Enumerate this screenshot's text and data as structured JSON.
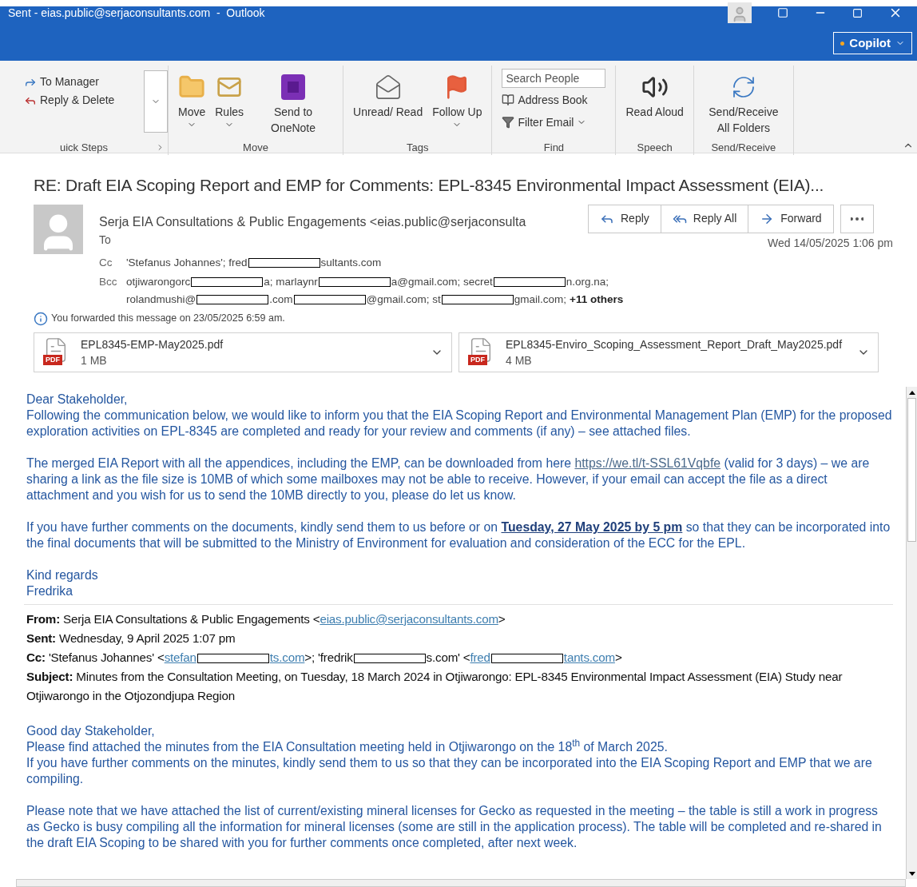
{
  "window": {
    "title": "Sent - eias.public@serjaconsultants.com  -  Outlook"
  },
  "copilot": {
    "label": "Copilot"
  },
  "ribbon": {
    "groups": [
      {
        "kind": "quicksteps",
        "label": "uick Steps",
        "items": [
          {
            "label": "To Manager"
          },
          {
            "label": "Reply & Delete"
          }
        ]
      },
      {
        "kind": "large",
        "label": "Move",
        "items": [
          {
            "label": "Move",
            "dropdown": true
          },
          {
            "label": "Rules",
            "dropdown": true
          },
          {
            "label": "Send to OneNote",
            "dropdown": false
          }
        ]
      },
      {
        "kind": "large",
        "label": "Tags",
        "items": [
          {
            "label": "Unread/ Read",
            "dropdown": false
          },
          {
            "label": "Follow Up",
            "dropdown": true
          }
        ]
      },
      {
        "kind": "find",
        "label": "Find",
        "search": {
          "placeholder": "Search People"
        },
        "items": [
          {
            "label": "Address Book",
            "dropdown": false
          },
          {
            "label": "Filter Email",
            "dropdown": true
          }
        ]
      },
      {
        "kind": "large",
        "label": "Speech",
        "items": [
          {
            "label": "Read Aloud",
            "dropdown": false
          }
        ]
      },
      {
        "kind": "large",
        "label": "Send/Receive",
        "items": [
          {
            "label": "Send/Receive All Folders",
            "dropdown": false
          }
        ]
      }
    ]
  },
  "message": {
    "subject": "RE: Draft EIA Scoping Report and EMP for Comments: EPL-8345 Environmental Impact Assessment (EIA)...",
    "sender": "Serja EIA Consultations & Public Engagements <eias.public@serjaconsulta",
    "date": "Wed 14/05/2025 1:06 pm",
    "actions": [
      {
        "label": "Reply"
      },
      {
        "label": "Reply All"
      },
      {
        "label": "Forward"
      }
    ],
    "to_label": "To",
    "recipients": [
      {
        "label": "Cc",
        "lines": [
          [
            {
              "kind": "text",
              "text": "'Stefanus Johannes'; fred"
            },
            {
              "kind": "redacted"
            },
            {
              "kind": "text",
              "text": "sultants.com"
            }
          ]
        ]
      },
      {
        "label": "Bcc",
        "lines": [
          [
            {
              "kind": "text",
              "text": "otjiwarongorc"
            },
            {
              "kind": "redacted"
            },
            {
              "kind": "text",
              "text": "a; marlaynr"
            },
            {
              "kind": "redacted"
            },
            {
              "kind": "text",
              "text": "a@gmail.com; secret"
            },
            {
              "kind": "redacted"
            },
            {
              "kind": "text",
              "text": "n.org.na;"
            }
          ],
          [
            {
              "kind": "text",
              "text": "rolandmushi@"
            },
            {
              "kind": "redacted"
            },
            {
              "kind": "text",
              "text": ".com"
            },
            {
              "kind": "redacted"
            },
            {
              "kind": "text",
              "text": "@gmail.com; st"
            },
            {
              "kind": "redacted"
            },
            {
              "kind": "text",
              "text": "gmail.com;"
            },
            {
              "kind": "bold",
              "text": "+11 others"
            }
          ]
        ]
      }
    ],
    "info": "You forwarded this message on 23/05/2025 6:59 am.",
    "attachments": [
      {
        "name": "EPL8345-EMP-May2025.pdf",
        "size": "1 MB",
        "badge": "PDF"
      },
      {
        "name": "EPL8345-Enviro_Scoping_Assessment_Report_Draft_May2025.pdf",
        "size": "4 MB",
        "badge": "PDF"
      }
    ]
  },
  "body": {
    "blocks": [
      [
        [
          {
            "kind": "text",
            "text": "Dear Stakeholder,"
          }
        ],
        [
          {
            "kind": "text",
            "text": "Following the communication below, we would like to inform you that the EIA Scoping Report and Environmental Management Plan (EMP) for the proposed exploration activities on EPL-8345 are completed and ready for your review and comments (if any) – see attached files."
          }
        ]
      ],
      [
        [
          {
            "kind": "text",
            "text": "The merged EIA Report with all the appendices, including the EMP, can be downloaded from here "
          },
          {
            "kind": "link",
            "text": "https://we.tl/t-SSL61Vqbfe"
          },
          {
            "kind": "text",
            "text": "  (valid for 3 days) – we are sharing a link as the file size is 10MB of which some mailboxes may not be able to receive. However, if your email can accept the file as a direct attachment and you wish for us to send the 10MB directly to you, please do let us know."
          }
        ]
      ],
      [
        [
          {
            "kind": "text",
            "text": "If you have further comments on the documents, kindly send them to us before or on "
          },
          {
            "kind": "emphasis",
            "text": "Tuesday, 27 May 2025 by 5 pm"
          },
          {
            "kind": "text",
            "text": " so that they can be incorporated into the final documents that will be submitted to the Ministry of Environment for evaluation and consideration of the ECC for the EPL."
          }
        ]
      ],
      [
        [
          {
            "kind": "text",
            "text": "Kind regards"
          }
        ],
        [
          {
            "kind": "text",
            "text": "Fredrika"
          }
        ]
      ]
    ],
    "forwarded": [
      {
        "label": "From:",
        "parts": [
          {
            "kind": "text",
            "text": "Serja EIA Consultations & Public Engagements <"
          },
          {
            "kind": "link",
            "text": "eias.public@serjaconsultants.com"
          },
          {
            "kind": "text",
            "text": ">"
          }
        ]
      },
      {
        "label": "Sent:",
        "parts": [
          {
            "kind": "text",
            "text": "Wednesday, 9 April 2025 1:07 pm"
          }
        ]
      },
      {
        "label": "Cc:",
        "parts": [
          {
            "kind": "text",
            "text": "'Stefanus Johannes' <"
          },
          {
            "kind": "link",
            "text": "stefan"
          },
          {
            "kind": "redacted"
          },
          {
            "kind": "link",
            "text": "ts.com"
          },
          {
            "kind": "text",
            "text": ">; 'fredrik"
          },
          {
            "kind": "redacted"
          },
          {
            "kind": "text",
            "text": "s.com' <"
          },
          {
            "kind": "link",
            "text": "fred"
          },
          {
            "kind": "redacted"
          },
          {
            "kind": "link",
            "text": "tants.com"
          },
          {
            "kind": "text",
            "text": ">"
          }
        ]
      },
      {
        "label": "Subject:",
        "parts": [
          {
            "kind": "text",
            "text": "Minutes from the Consultation Meeting, on Tuesday, 18 March 2024 in Otjiwarongo: EPL-8345 Environmental Impact Assessment (EIA) Study near Otjiwarongo in the Otjozondjupa Region"
          }
        ]
      }
    ],
    "blocks2": [
      [
        [
          {
            "kind": "text",
            "text": "Good day Stakeholder,"
          }
        ],
        [
          {
            "kind": "text",
            "text": "Please find attached the minutes from the EIA Consultation meeting held in Otjiwarongo on the 18$^{th}$ of March 2025."
          }
        ],
        [
          {
            "kind": "text",
            "text": "If you have further comments on the minutes, kindly send them to us so that they can be incorporated into the EIA Scoping Report and EMP that we are compiling."
          }
        ]
      ],
      [
        [
          {
            "kind": "text",
            "text": "Please note that we have attached the list of current/existing mineral licenses for Gecko as requested in the meeting – the table is still a work in progress as Gecko is busy compiling all the information for mineral licenses (some are still in the application process). The table will be completed and re-shared in the draft EIA Scoping to be shared with you for further comments once completed, after next week."
          }
        ]
      ]
    ]
  }
}
